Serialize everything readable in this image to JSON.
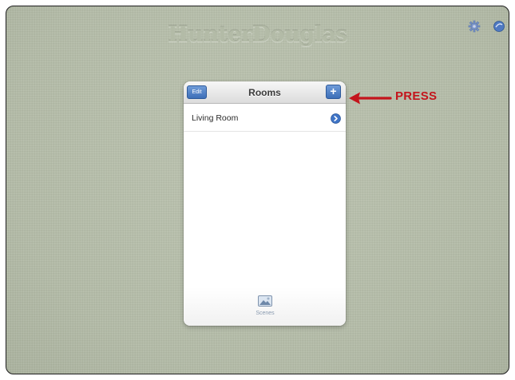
{
  "app": {
    "brand": "HunterDouglas"
  },
  "toolbar": {
    "settings_icon": "gear-icon",
    "info_icon": "info-icon"
  },
  "rooms_panel": {
    "edit_label": "Edit",
    "title": "Rooms",
    "add_label": "+",
    "rooms": [
      {
        "name": "Living Room",
        "icon": "chevron-right-circle-icon"
      }
    ],
    "tabs": [
      {
        "label": "Scenes",
        "icon": "scenes-picture-icon"
      }
    ]
  },
  "annotation": {
    "label": "PRESS",
    "arrow_icon": "arrow-left-icon",
    "color": "#c4151c"
  },
  "colors": {
    "background": "#b8c0ac",
    "button_blue": "#4a7cc4"
  }
}
